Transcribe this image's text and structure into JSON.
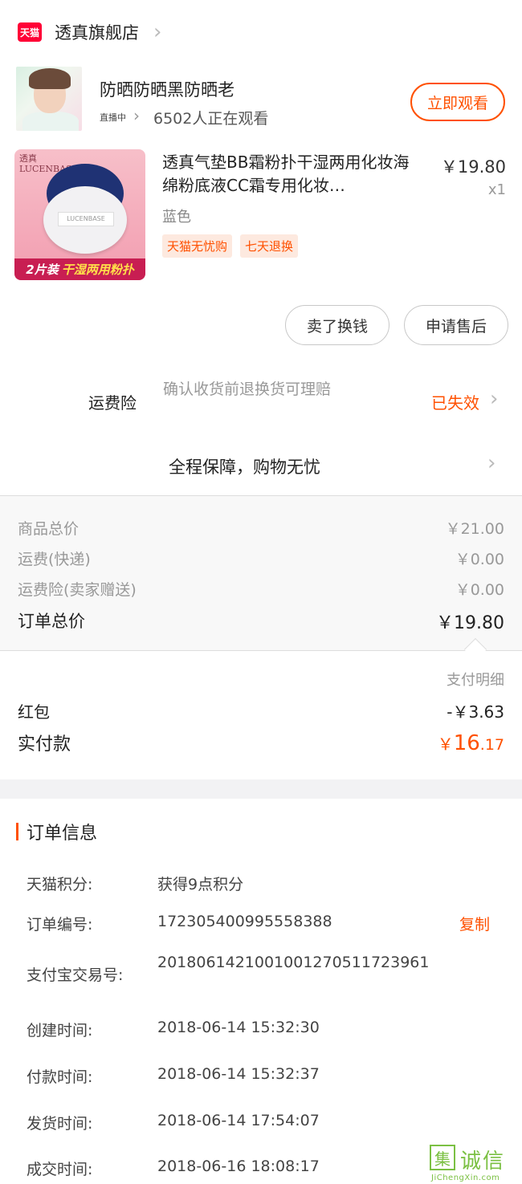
{
  "store": {
    "badge": "天猫",
    "name": "透真旗舰店"
  },
  "live": {
    "title": "防晒防晒黑防晒老",
    "status": "直播中",
    "viewers": "6502人正在观看",
    "watch_button": "立即观看"
  },
  "product": {
    "image_brand": "透真\nLUCENBASE",
    "image_strap": "LUCENBASE",
    "image_banner_prefix": "2片装",
    "image_banner_highlight": "干湿两用粉扑",
    "title": "透真气垫BB霜粉扑干湿两用化妆海绵粉底液CC霜专用化妆…",
    "price": "￥19.80",
    "quantity": "x1",
    "variant": "蓝色",
    "tags": [
      "天猫无忧购",
      "七天退换"
    ]
  },
  "actions": {
    "sell": "卖了换钱",
    "after_sale": "申请售后"
  },
  "freight_insurance": {
    "label": "运费险",
    "description": "确认收货前退换货可理赔",
    "status": "已失效"
  },
  "guarantee": {
    "text": "全程保障，购物无忧"
  },
  "price_summary": {
    "rows": [
      {
        "label": "商品总价",
        "value": "￥21.00"
      },
      {
        "label": "运费(快递)",
        "value": "￥0.00"
      },
      {
        "label": "运费险(卖家赠送)",
        "value": "￥0.00"
      }
    ],
    "total_label": "订单总价",
    "total_value": "￥19.80"
  },
  "payment": {
    "detail_link": "支付明细",
    "red_packet_label": "红包",
    "red_packet_value": "-￥3.63",
    "paid_label": "实付款",
    "paid_currency": "￥",
    "paid_integer": "16",
    "paid_decimal": ".17"
  },
  "order_info": {
    "title": "订单信息",
    "copy_button": "复制",
    "rows": [
      {
        "label": "天猫积分:",
        "value": "获得9点积分"
      },
      {
        "label": "订单编号:",
        "value": "172305400995558388"
      },
      {
        "label": "支付宝交易号:",
        "value": "2018061421001001270511723961"
      },
      {
        "label": "创建时间:",
        "value": "2018-06-14 15:32:30"
      },
      {
        "label": "付款时间:",
        "value": "2018-06-14 15:32:37"
      },
      {
        "label": "发货时间:",
        "value": "2018-06-14 17:54:07"
      },
      {
        "label": "成交时间:",
        "value": "2018-06-16 18:08:17"
      }
    ]
  },
  "watermark": {
    "box_char": "集",
    "text": "诚信",
    "url": "JiChengXin.com"
  },
  "colors": {
    "accent": "#ff5000",
    "tmall_red": "#ff0036",
    "watermark_green": "#7bc043"
  }
}
